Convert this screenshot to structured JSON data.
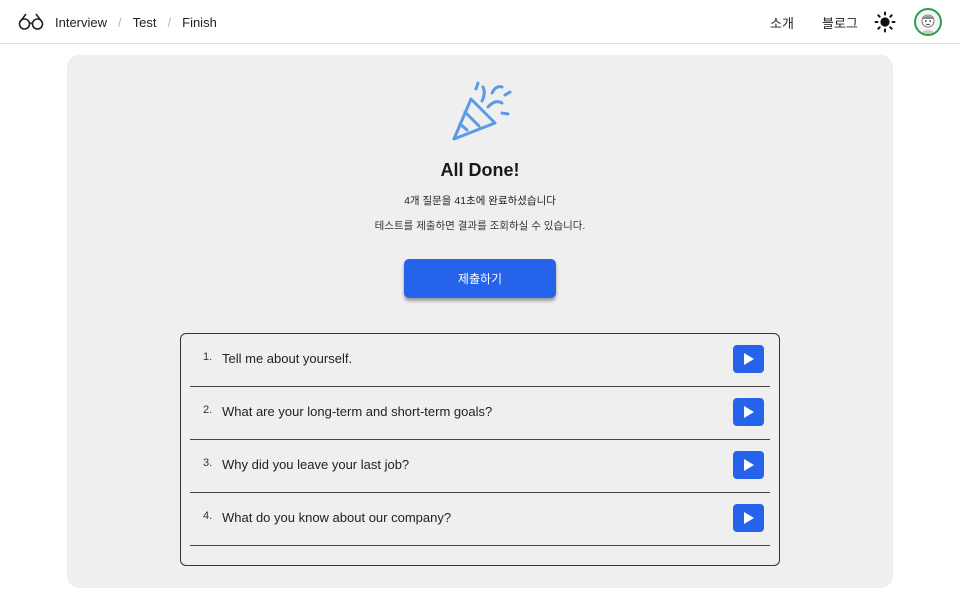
{
  "header": {
    "logo_icon": "glasses-icon",
    "breadcrumbs": [
      "Interview",
      "Test",
      "Finish"
    ],
    "breadcrumb_separator": "/",
    "nav": {
      "intro": "소개",
      "blog": "블로그"
    },
    "theme_icon": "sun-icon",
    "avatar_icon": "avatar-icon"
  },
  "main": {
    "celebration_icon": "party-popper-icon",
    "title": "All Done!",
    "summary": "4개 질문을 41초에 완료하셨습니다",
    "hint": "테스트를 제출하면 결과를 조회하실 수 있습니다.",
    "submit_label": "제출하기",
    "questions": [
      {
        "number": "1.",
        "text": "Tell me about yourself."
      },
      {
        "number": "2.",
        "text": "What are your long-term and short-term goals?"
      },
      {
        "number": "3.",
        "text": "Why did you leave your last job?"
      },
      {
        "number": "4.",
        "text": "What do you know about our company?"
      }
    ],
    "play_icon": "play-icon"
  },
  "colors": {
    "accent": "#2563eb",
    "card_bg": "#efefef",
    "avatar_ring": "#27a14a",
    "party_icon": "#5b9ae6"
  }
}
